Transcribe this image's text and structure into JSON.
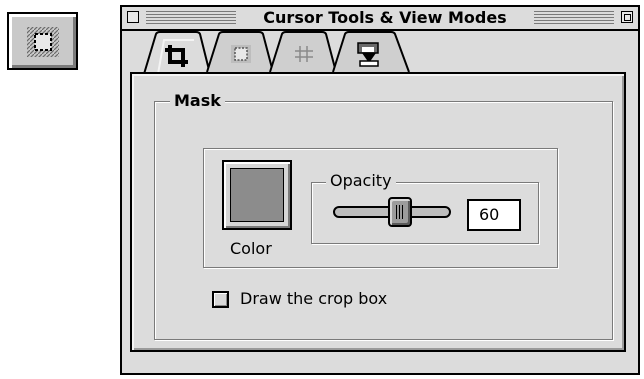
{
  "window": {
    "title": "Cursor Tools & View Modes"
  },
  "tool_button": {
    "icon": "marquee-mask-icon"
  },
  "tabs": [
    {
      "icon": "crop-icon",
      "active": true
    },
    {
      "icon": "marquee-mask-icon",
      "active": false
    },
    {
      "icon": "grid-icon",
      "active": false
    },
    {
      "icon": "view-mode-icon",
      "active": false
    }
  ],
  "mask": {
    "group_label": "Mask",
    "color_label": "Color",
    "color_value": "#8c8c8c",
    "opacity": {
      "group_label": "Opacity",
      "value": "60",
      "level_percent": 60
    },
    "draw_crop_box": {
      "label": "Draw the crop box",
      "checked": false
    }
  }
}
